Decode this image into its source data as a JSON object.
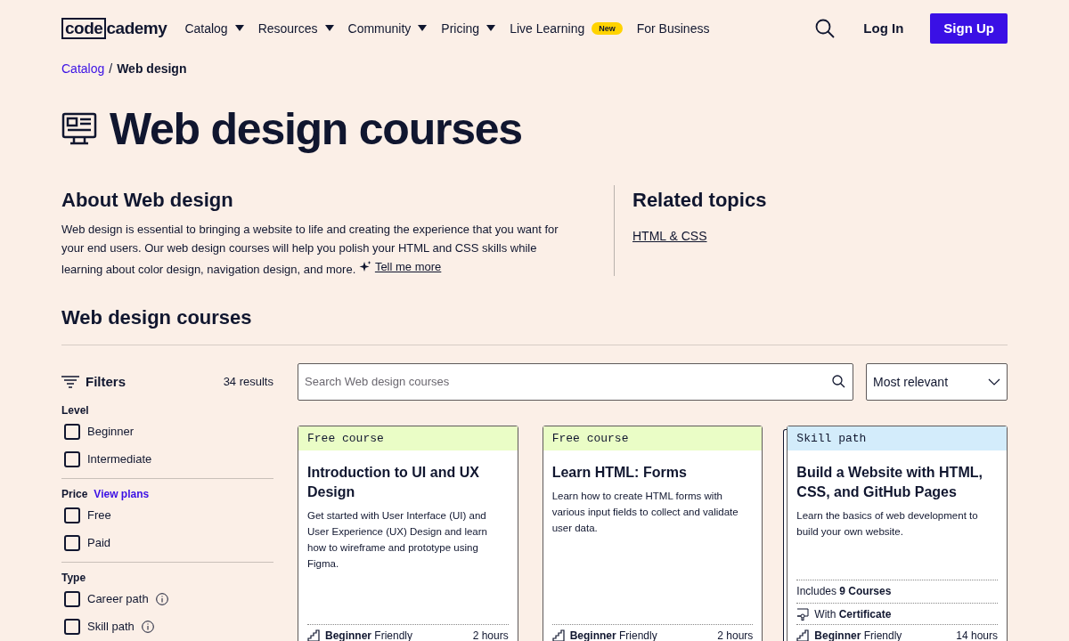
{
  "logo": {
    "boxed": "code",
    "rest": "cademy"
  },
  "nav": [
    {
      "label": "Catalog",
      "dropdown": true
    },
    {
      "label": "Resources",
      "dropdown": true
    },
    {
      "label": "Community",
      "dropdown": true
    },
    {
      "label": "Pricing",
      "dropdown": true
    },
    {
      "label": "Live Learning",
      "dropdown": false,
      "badge": "New"
    },
    {
      "label": "For Business",
      "dropdown": false
    }
  ],
  "actions": {
    "login": "Log In",
    "signup": "Sign Up"
  },
  "breadcrumb": {
    "link": "Catalog",
    "separator": "/",
    "current": "Web design"
  },
  "page_title": "Web design courses",
  "about": {
    "heading": "About Web design",
    "text": "Web design is essential to bringing a website to life and creating the experience that you want for your end users. Our web design courses will help you polish your HTML and CSS skills while learning about color design, navigation design, and more.",
    "link": "Tell me more"
  },
  "related": {
    "heading": "Related topics",
    "links": [
      "HTML & CSS"
    ]
  },
  "section_title": "Web design courses",
  "filters": {
    "title": "Filters",
    "count": "34 results",
    "groups": [
      {
        "label": "Level",
        "options": [
          {
            "label": "Beginner",
            "checked": false,
            "info": false
          },
          {
            "label": "Intermediate",
            "checked": false,
            "info": false
          }
        ]
      },
      {
        "label": "Price",
        "link": "View plans",
        "options": [
          {
            "label": "Free",
            "checked": false,
            "info": false
          },
          {
            "label": "Paid",
            "checked": false,
            "info": false
          }
        ]
      },
      {
        "label": "Type",
        "options": [
          {
            "label": "Career path",
            "checked": false,
            "info": true
          },
          {
            "label": "Skill path",
            "checked": false,
            "info": true
          }
        ]
      }
    ]
  },
  "search": {
    "placeholder": "Search Web design courses"
  },
  "sort": {
    "value": "Most relevant"
  },
  "cards": [
    {
      "kind": "free_course",
      "tag": "Free course",
      "title": "Introduction to UI and UX Design",
      "description": "Get started with User Interface (UI) and User Experience (UX) Design and learn how to wireframe and prototype using Figma.",
      "level": "**Beginner** Friendly",
      "duration": "2 hours"
    },
    {
      "kind": "free_course",
      "tag": "Free course",
      "title": "Learn HTML: Forms",
      "description": "Learn how to create HTML forms with various input fields to collect and validate user data.",
      "level": "**Beginner** Friendly",
      "duration": "2 hours"
    },
    {
      "kind": "skill_path",
      "tag": "Skill path",
      "title": "Build a Website with HTML, CSS, and GitHub Pages",
      "description": "Learn the basics of web development to build your own website.",
      "includes": "Includes **9 Courses**",
      "certificate": "With **Certificate**",
      "level": "**Beginner** Friendly",
      "duration": "14 hours"
    }
  ]
}
